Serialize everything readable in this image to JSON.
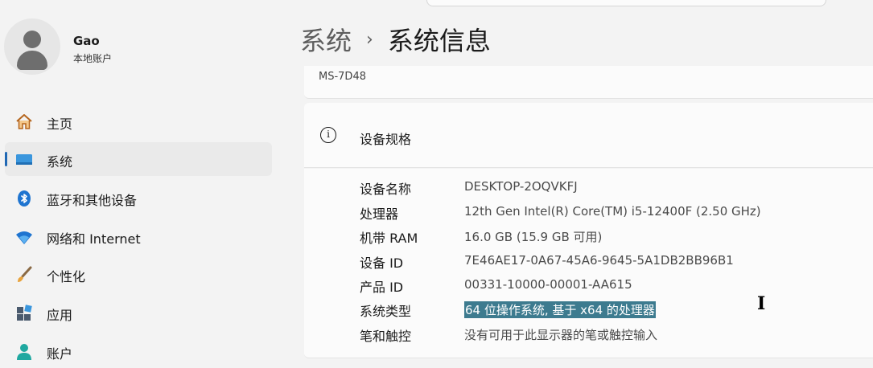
{
  "user": {
    "name": "Gao",
    "account_type": "本地账户"
  },
  "sidebar": {
    "items": [
      {
        "label": "主页",
        "icon": "home-icon"
      },
      {
        "label": "系统",
        "icon": "system-icon",
        "selected": true
      },
      {
        "label": "蓝牙和其他设备",
        "icon": "bluetooth-icon"
      },
      {
        "label": "网络和 Internet",
        "icon": "wifi-icon"
      },
      {
        "label": "个性化",
        "icon": "brush-icon"
      },
      {
        "label": "应用",
        "icon": "apps-icon"
      },
      {
        "label": "账户",
        "icon": "account-icon"
      }
    ]
  },
  "breadcrumb": {
    "parent": "系统",
    "separator": "›",
    "current": "系统信息"
  },
  "model": "MS-7D48",
  "device_specs": {
    "title": "设备规格",
    "rows": [
      {
        "key": "设备名称",
        "value": "DESKTOP-2OQVKFJ"
      },
      {
        "key": "处理器",
        "value": "12th Gen Intel(R) Core(TM) i5-12400F (2.50 GHz)"
      },
      {
        "key": "机带 RAM",
        "value": "16.0 GB (15.9 GB 可用)"
      },
      {
        "key": "设备 ID",
        "value": "7E46AE17-0A67-45A6-9645-5A1DB2BB96B1"
      },
      {
        "key": "产品 ID",
        "value": "00331-10000-00001-AA615"
      },
      {
        "key": "系统类型",
        "value": "64 位操作系统, 基于 x64 的处理器",
        "selected_text": true
      },
      {
        "key": "笔和触控",
        "value": "没有可用于此显示器的笔或触控输入"
      }
    ]
  },
  "colors": {
    "accent": "#2068b4",
    "selection": "#3d7b8f"
  }
}
